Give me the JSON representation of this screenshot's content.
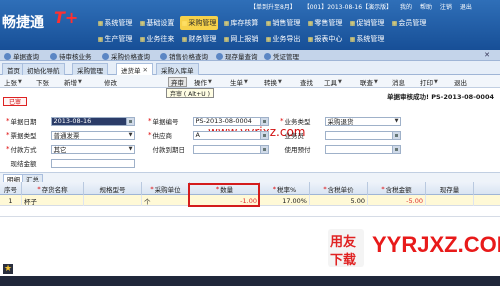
{
  "header": {
    "logo_text": "畅捷通",
    "logo_mark": "T+",
    "topbar": [
      "【单到升至8月】",
      "【001】2013-08-16【演示版】",
      "我的",
      "帮助",
      "注销",
      "退出"
    ],
    "main_nav": [
      "基础设置",
      "采购管理",
      "库存核算",
      "销售管理",
      "零售管理",
      "促销管理",
      "会员管理"
    ],
    "sub_nav": [
      "生产管理",
      "业务往来",
      "财务管理",
      "网上报销",
      "业务导出",
      "报表中心",
      "系统管理"
    ],
    "active_main": "采购管理",
    "first_nav": "系统管理"
  },
  "quickstrip": [
    "单据查询",
    "待审核业务",
    "采购价格查询",
    "销售价格查询",
    "现存量查询",
    "凭证管理"
  ],
  "tabs": [
    "首页",
    "初始化导航",
    "采购管理",
    "进货单",
    "采购入库单"
  ],
  "toolbar": [
    "上张",
    "下张",
    "新增",
    "修改",
    "弃审",
    "操作",
    "生单",
    "转换",
    "查找",
    "工具",
    "联查",
    "消息",
    "打印",
    "退出"
  ],
  "tooltip": "弃审 ( Alt+U )",
  "status": "已审",
  "approve_message": "单据审核成功! PS-2013-08-0004",
  "watermark": "www.yyrjxz.com",
  "form": {
    "labels": {
      "date": "单据日期",
      "code": "单据编号",
      "biz_type": "业务类型",
      "invoice_type": "票据类型",
      "supplier": "供应商",
      "clerk": "业务员",
      "payment": "付款方式",
      "due_date": "付款到期日",
      "prepay": "使用预付",
      "cash": "现结金额"
    },
    "values": {
      "date": "2013-08-16",
      "code": "PS-2013-08-0004",
      "biz_type": "采购退货",
      "invoice_type": "普通发票",
      "supplier": "A",
      "clerk": "",
      "payment": "其它",
      "due_date": "",
      "prepay": "",
      "cash": ""
    }
  },
  "detail_tabs": [
    "明细",
    "汇总"
  ],
  "table": {
    "headers": [
      "序号",
      "存货名称",
      "规格型号",
      "采购单位",
      "数量",
      "税率%",
      "含税单价",
      "含税金额",
      "现存量"
    ],
    "rows": [
      [
        "1",
        "杯子",
        "",
        "个",
        "-1.00",
        "17.00%",
        "5.00",
        "-5.00",
        ""
      ]
    ]
  },
  "bottom_logo": [
    "用友",
    "下载"
  ],
  "bottom_url": "YYRJXZ.COM"
}
